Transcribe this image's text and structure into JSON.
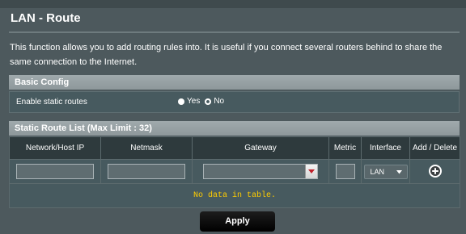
{
  "page": {
    "title": "LAN - Route",
    "description": "This function allows you to add routing rules into. It is useful if you connect several routers behind to share the same connection to the Internet."
  },
  "basic_config": {
    "header": "Basic Config",
    "enable_label": "Enable static routes",
    "options": [
      "Yes",
      "No"
    ],
    "selected": "No"
  },
  "route_list": {
    "header": "Static Route List (Max Limit : 32)",
    "columns": [
      "Network/Host IP",
      "Netmask",
      "Gateway",
      "Metric",
      "Interface",
      "Add / Delete"
    ],
    "inputs": {
      "network_host_ip": "",
      "netmask": "",
      "gateway": "",
      "metric": "",
      "interface": "LAN"
    },
    "add_icon": "plus-circle-icon",
    "empty_message": "No data in table."
  },
  "actions": {
    "apply_label": "Apply"
  },
  "colors": {
    "background": "#4d595d",
    "section_header": "#929c9f",
    "table_header": "#2e3a3d",
    "empty_message": "#ffcc00",
    "apply_button": "#000000"
  }
}
